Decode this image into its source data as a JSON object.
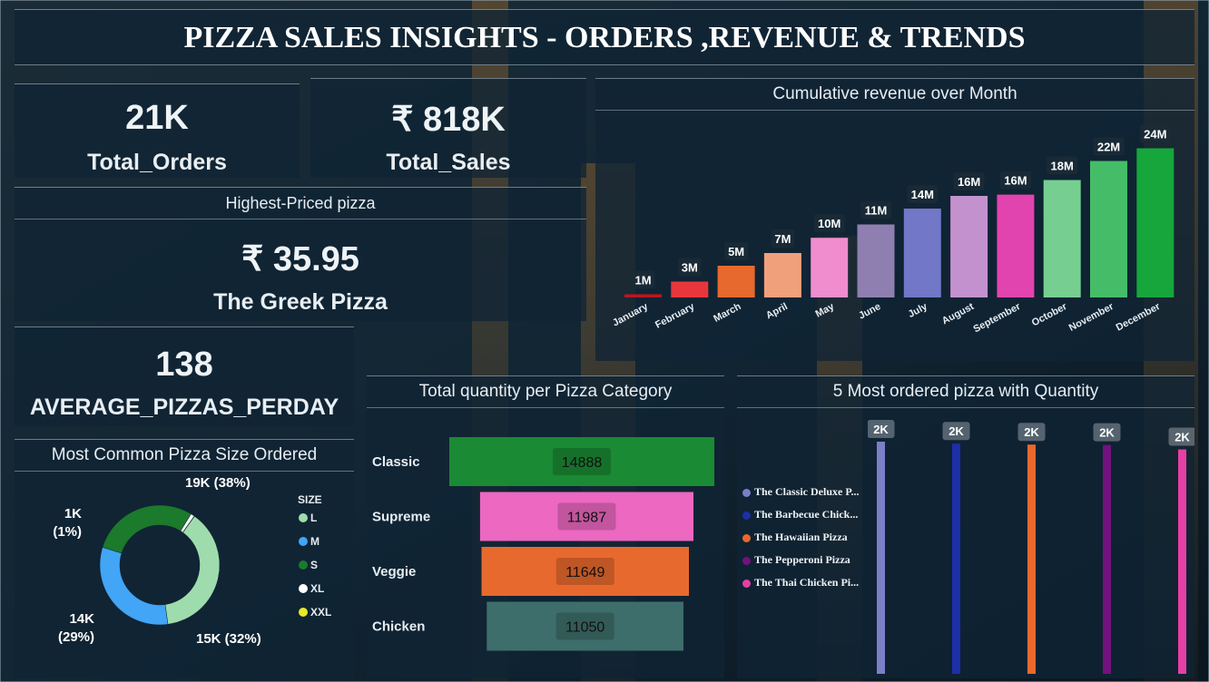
{
  "header": {
    "title": "PIZZA SALES INSIGHTS - ORDERS ,REVENUE & TRENDS"
  },
  "kpis": {
    "orders": {
      "value": "21K",
      "label": "Total_Orders"
    },
    "sales": {
      "value": "₹ 818K",
      "label": "Total_Sales"
    },
    "highest": {
      "title": "Highest-Priced pizza",
      "value": "₹ 35.95",
      "name": "The Greek Pizza"
    },
    "avg": {
      "value": "138",
      "label": "AVERAGE_PIZZAS_PERDAY"
    }
  },
  "colors": {
    "panel_bg": "#102434",
    "grid_line": "#dce6f0"
  },
  "chart_data": [
    {
      "type": "bar",
      "title": "Cumulative revenue over Month",
      "categories": [
        "January",
        "February",
        "March",
        "April",
        "May",
        "June",
        "July",
        "August",
        "September",
        "October",
        "November",
        "December"
      ],
      "values": [
        0.5,
        2.5,
        5,
        7,
        9.4,
        11.5,
        14,
        16,
        16.2,
        18.5,
        21.5,
        23.5
      ],
      "data_labels": [
        "1M",
        "3M",
        "5M",
        "7M",
        "10M",
        "11M",
        "14M",
        "16M",
        "16M",
        "18M",
        "22M",
        "24M"
      ],
      "colors": [
        "#c0141c",
        "#e8373c",
        "#e8692e",
        "#f1a07c",
        "#ef8dcf",
        "#8f7fb1",
        "#7277c8",
        "#c491cf",
        "#e244af",
        "#76cf90",
        "#45bd68",
        "#16a63c"
      ],
      "ylim": [
        0,
        24
      ]
    },
    {
      "type": "pie",
      "title": "Most Common Pizza Size Ordered",
      "legend_title": "SIZE",
      "categories": [
        "L",
        "M",
        "S",
        "XL",
        "XXL"
      ],
      "values": [
        38,
        32,
        29,
        1,
        0.1
      ],
      "colors": [
        "#9fdcad",
        "#42a5f5",
        "#1b7a2c",
        "#ffffff",
        "#e8e82a"
      ],
      "data_labels": [
        {
          "line1": "19K (38%)",
          "line2": ""
        },
        {
          "line1": "15K (32%)",
          "line2": ""
        },
        {
          "line1": "14K",
          "line2": "(29%)"
        },
        {
          "line1": "1K",
          "line2": "(1%)"
        }
      ],
      "legend_placement": "right"
    },
    {
      "type": "bar",
      "orientation": "horizontal",
      "title": "Total quantity per Pizza Category",
      "categories": [
        "Classic",
        "Supreme",
        "Veggie",
        "Chicken"
      ],
      "values": [
        14888,
        11987,
        11649,
        11050
      ],
      "data_labels": [
        "14888",
        "11987",
        "11649",
        "11050"
      ],
      "colors": [
        "#1a8a34",
        "#ec68c1",
        "#e8692e",
        "#3d6e6b"
      ]
    },
    {
      "type": "bar",
      "title": "5 Most ordered pizza with Quantity",
      "categories": [
        "The Classic Deluxe P...",
        "The Barbecue Chick...",
        "The Hawaiian Pizza",
        "The Pepperoni Pizza",
        "The Thai Chicken Pi..."
      ],
      "values": [
        2453,
        2432,
        2422,
        2418,
        2371
      ],
      "data_labels": [
        "2K",
        "2K",
        "2K",
        "2K",
        "2K"
      ],
      "colors": [
        "#7b7fc9",
        "#1c2fa8",
        "#e8692e",
        "#73117e",
        "#e63fa6"
      ],
      "legend_placement": "left"
    }
  ]
}
